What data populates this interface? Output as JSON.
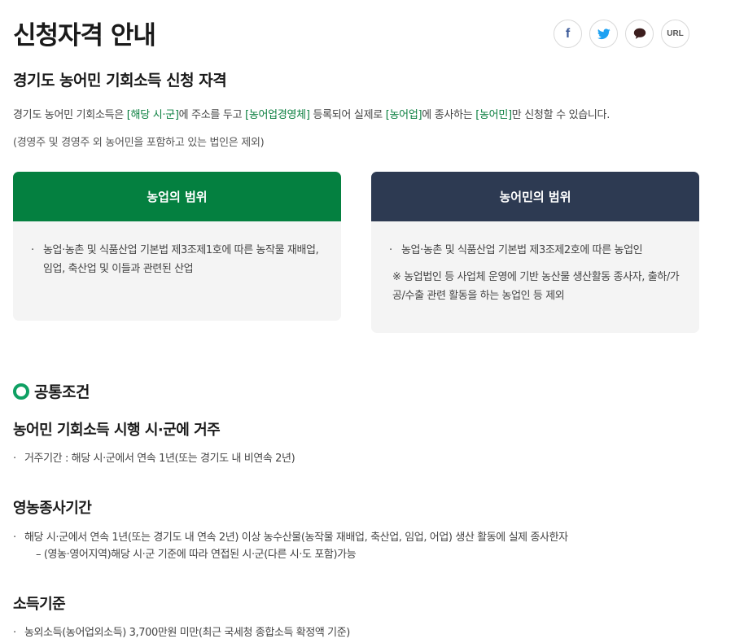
{
  "page": {
    "title": "신청자격 안내",
    "share": [
      {
        "name": "facebook",
        "icon": "facebook-icon",
        "label": "f"
      },
      {
        "name": "twitter",
        "icon": "twitter-icon"
      },
      {
        "name": "kakaotalk",
        "icon": "speech-bubble-icon"
      },
      {
        "name": "url",
        "icon": "link-icon",
        "label": "URL"
      }
    ]
  },
  "intro": {
    "heading": "경기도 농어민 기회소득 신청 자격",
    "sentence": {
      "p1": "경기도 농어민 기회소득은 ",
      "h1": "[해당 시·군]",
      "p2": "에 주소를 두고 ",
      "h2": "[농어업경영체]",
      "p3": " 등록되어 실제로 ",
      "h3": "[농어업]",
      "p4": "에 종사하는 ",
      "h4": "[농어민]",
      "p5": "만 신청할 수 있습니다."
    },
    "note": "(경영주 및 경영주 외 농어민을 포함하고 있는 법인은 제외)"
  },
  "cards": {
    "farming": {
      "title": "농업의 범위",
      "bullet": "농업·농촌 및 식품산업 기본법 제3조제1호에 따른 농작물 재배업, 임업, 축산업 및 이들과 관련된 산업"
    },
    "farmer": {
      "title": "농어민의 범위",
      "bullet": "농업·농촌 및 식품산업 기본법 제3조제2호에 따른 농업인",
      "note": "※  농업법인 등 사업체 운영에 기반 농산물 생산활동 종사자, 출하/가공/수출 관련 활동을 하는 농업인 등 제외"
    }
  },
  "common": {
    "heading": "공통조건",
    "residence": {
      "title": "농어민 기회소득 시행 시·군에 거주",
      "text": "거주기간 : 해당 시·군에서 연속 1년(또는 경기도 내 비연속 2년)"
    },
    "work_period": {
      "title": "영농종사기간",
      "text": "해당 시·군에서 연속 1년(또는 경기도 내 연속 2년) 이상 농수산물(농작물 재배업, 축산업, 임업, 어업) 생산 활동에 실제 종사한자",
      "sub": "– (영농·영어지역)해당 시·군 기준에 따라 연접된 시·군(다른 시·도 포함)가능"
    },
    "income": {
      "title": "소득기준",
      "text": "농외소득(농어업외소득) 3,700만원 미만(최근 국세청 종합소득 확정액 기준)"
    }
  },
  "colors": {
    "green": "#048040",
    "navy": "#2d3a52",
    "highlight": "#0a7f3f",
    "accent": "#0fa063"
  }
}
